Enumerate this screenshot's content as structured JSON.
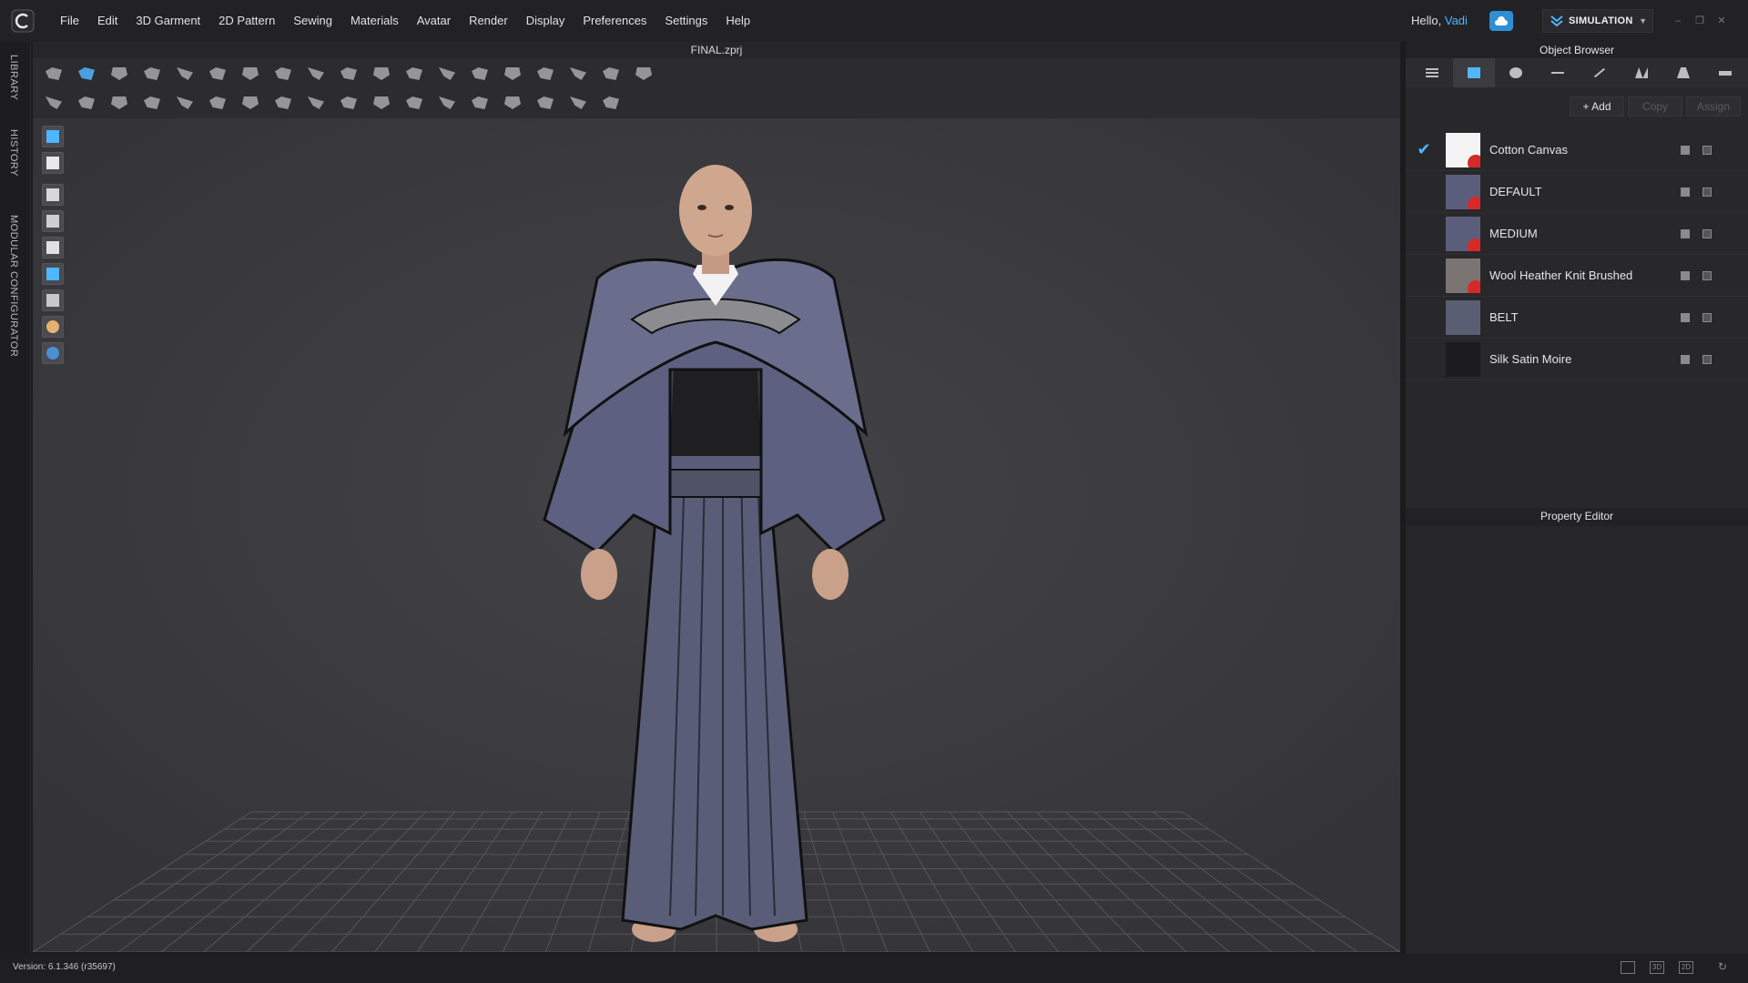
{
  "app": {
    "menu": [
      "File",
      "Edit",
      "3D Garment",
      "2D Pattern",
      "Sewing",
      "Materials",
      "Avatar",
      "Render",
      "Display",
      "Preferences",
      "Settings",
      "Help"
    ],
    "greeting_prefix": "Hello,",
    "username": "Vadi",
    "mode": "SIMULATION",
    "accent_color": "#4fb6ff"
  },
  "left_tabs": [
    "LIBRARY",
    "HISTORY",
    "MODULAR CONFIGURATOR"
  ],
  "viewport": {
    "file_name": "FINAL.zprj"
  },
  "object_browser": {
    "title": "Object Browser",
    "tabs": [
      "list-icon",
      "fabric-icon",
      "button-icon",
      "line-icon",
      "pen-icon",
      "pattern-icon",
      "avatar-icon",
      "ruler-icon"
    ],
    "actions": {
      "add": "+ Add",
      "copy": "Copy",
      "assign": "Assign"
    },
    "materials": [
      {
        "name": "Cotton Canvas",
        "selected": true,
        "thumb_color": "#f4f4f4"
      },
      {
        "name": "DEFAULT",
        "selected": false,
        "thumb_color": "#5b5e7a"
      },
      {
        "name": "MEDIUM",
        "selected": false,
        "thumb_color": "#5b5e7a"
      },
      {
        "name": "Wool Heather Knit Brushed",
        "selected": false,
        "thumb_color": "#7a7472"
      },
      {
        "name": "BELT",
        "selected": false,
        "thumb_color": "#5a5e72"
      },
      {
        "name": "Silk Satin Moire",
        "selected": false,
        "thumb_color": "#1c1c1e"
      }
    ]
  },
  "property_editor": {
    "title": "Property Editor"
  },
  "status": {
    "version": "Version: 6.1.346 (r35697)"
  }
}
